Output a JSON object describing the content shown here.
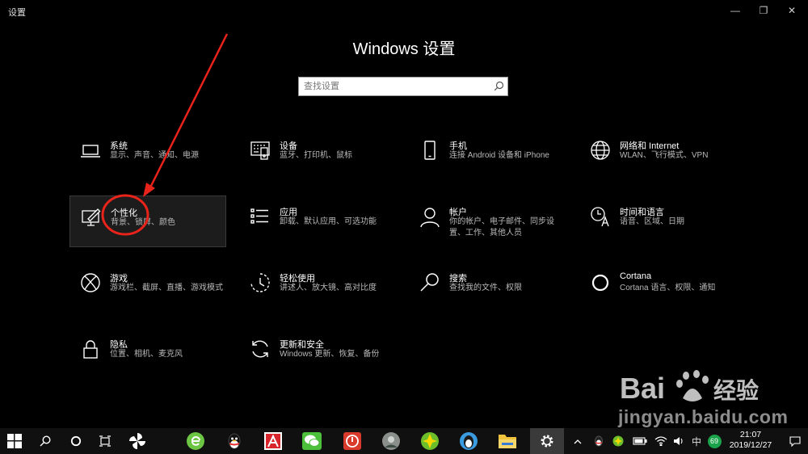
{
  "window": {
    "title": "设置",
    "controls": {
      "minimize": "—",
      "maximize": "❐",
      "close": "✕"
    }
  },
  "page_title": "Windows 设置",
  "search": {
    "placeholder": "查找设置",
    "value": ""
  },
  "categories": [
    {
      "id": "system",
      "icon": "laptop-icon",
      "name": "系统",
      "desc": "显示、声音、通知、电源"
    },
    {
      "id": "devices",
      "icon": "keyboard-icon",
      "name": "设备",
      "desc": "蓝牙、打印机、鼠标"
    },
    {
      "id": "phone",
      "icon": "phone-icon",
      "name": "手机",
      "desc": "连接 Android 设备和 iPhone"
    },
    {
      "id": "network",
      "icon": "globe-icon",
      "name": "网络和 Internet",
      "desc": "WLAN、飞行模式、VPN"
    },
    {
      "id": "personalization",
      "icon": "paint-icon",
      "name": "个性化",
      "desc": "背景、锁屏、颜色",
      "selected": true
    },
    {
      "id": "apps",
      "icon": "list-icon",
      "name": "应用",
      "desc": "卸载、默认应用、可选功能"
    },
    {
      "id": "accounts",
      "icon": "person-icon",
      "name": "帐户",
      "desc": "你的帐户、电子邮件、同步设置、工作、其他人员"
    },
    {
      "id": "time-language",
      "icon": "clock-language-icon",
      "name": "时间和语言",
      "desc": "语音、区域、日期"
    },
    {
      "id": "gaming",
      "icon": "xbox-icon",
      "name": "游戏",
      "desc": "游戏栏、截屏、直播、游戏模式"
    },
    {
      "id": "ease-of-access",
      "icon": "ease-of-access-icon",
      "name": "轻松使用",
      "desc": "讲述人、放大镜、高对比度"
    },
    {
      "id": "search",
      "icon": "search-icon",
      "name": "搜索",
      "desc": "查找我的文件、权限"
    },
    {
      "id": "cortana",
      "icon": "cortana-circle-icon",
      "name": "Cortana",
      "desc": "Cortana 语言、权限、通知"
    },
    {
      "id": "privacy",
      "icon": "lock-icon",
      "name": "隐私",
      "desc": "位置、相机、麦克风"
    },
    {
      "id": "update-security",
      "icon": "refresh-icon",
      "name": "更新和安全",
      "desc": "Windows 更新、恢复、备份"
    }
  ],
  "watermark": {
    "brand": "Bai",
    "brand2": "经验",
    "url": "jingyan.baidu.com"
  },
  "taskbar": {
    "tray": {
      "ime": "中",
      "badge": "69",
      "time": "21:07",
      "date": "2019/12/27"
    }
  },
  "colors": {
    "background": "#000000",
    "annotation": "#e8231a",
    "taskbar": "#101010"
  }
}
